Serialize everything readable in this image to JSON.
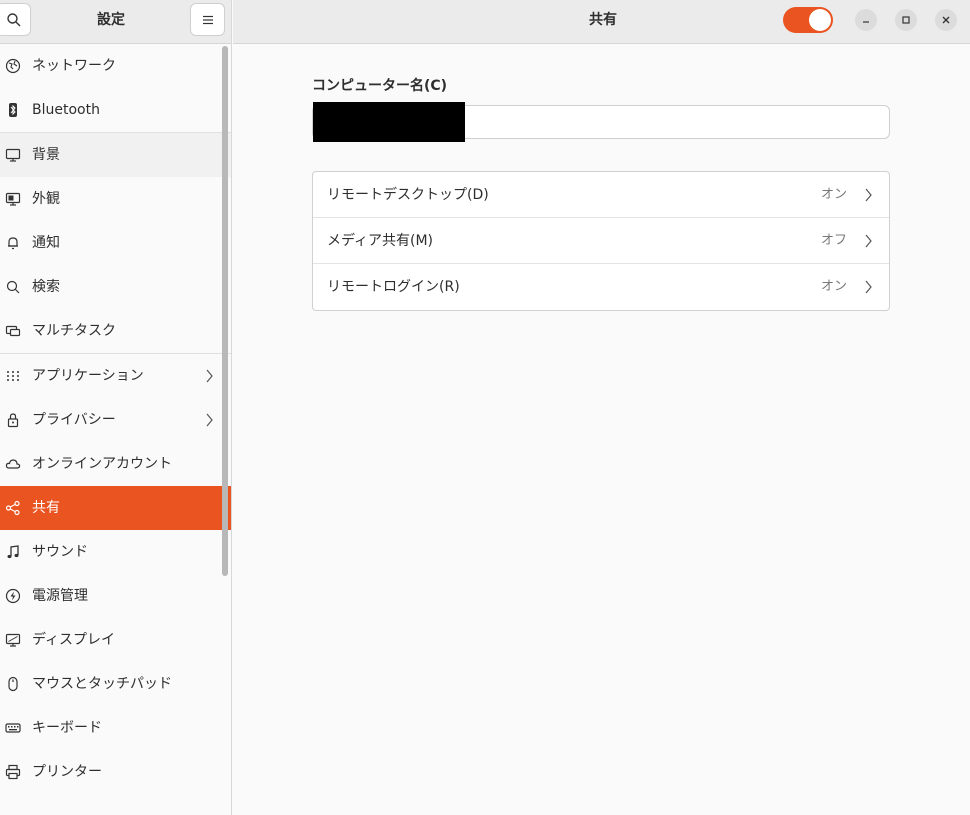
{
  "sidebar": {
    "title": "設定",
    "search_icon": "search-icon",
    "menu_icon": "hamburger-menu-icon",
    "items": [
      {
        "label": "ネットワーク",
        "icon": "network-globe-icon"
      },
      {
        "label": "Bluetooth",
        "icon": "bluetooth-icon"
      },
      {
        "label": "背景",
        "icon": "background-monitor-icon"
      },
      {
        "label": "外観",
        "icon": "appearance-icon"
      },
      {
        "label": "通知",
        "icon": "bell-icon"
      },
      {
        "label": "検索",
        "icon": "search-icon"
      },
      {
        "label": "マルチタスク",
        "icon": "multitask-icon"
      },
      {
        "label": "アプリケーション",
        "icon": "apps-grid-icon"
      },
      {
        "label": "プライバシー",
        "icon": "lock-icon"
      },
      {
        "label": "オンラインアカウント",
        "icon": "cloud-icon"
      },
      {
        "label": "共有",
        "icon": "share-icon"
      },
      {
        "label": "サウンド",
        "icon": "music-note-icon"
      },
      {
        "label": "電源管理",
        "icon": "power-icon"
      },
      {
        "label": "ディスプレイ",
        "icon": "display-icon"
      },
      {
        "label": "マウスとタッチパッド",
        "icon": "mouse-icon"
      },
      {
        "label": "キーボード",
        "icon": "keyboard-icon"
      },
      {
        "label": "プリンター",
        "icon": "printer-icon"
      }
    ]
  },
  "header": {
    "title": "共有",
    "sharing_toggle": "on"
  },
  "main": {
    "computer_name_label": "コンピューター名(C)",
    "rows": [
      {
        "label": "リモートデスクトップ(D)",
        "value": "オン"
      },
      {
        "label": "メディア共有(M)",
        "value": "オフ"
      },
      {
        "label": "リモートログイン(R)",
        "value": "オン"
      }
    ]
  },
  "colors": {
    "accent": "#e95420"
  }
}
